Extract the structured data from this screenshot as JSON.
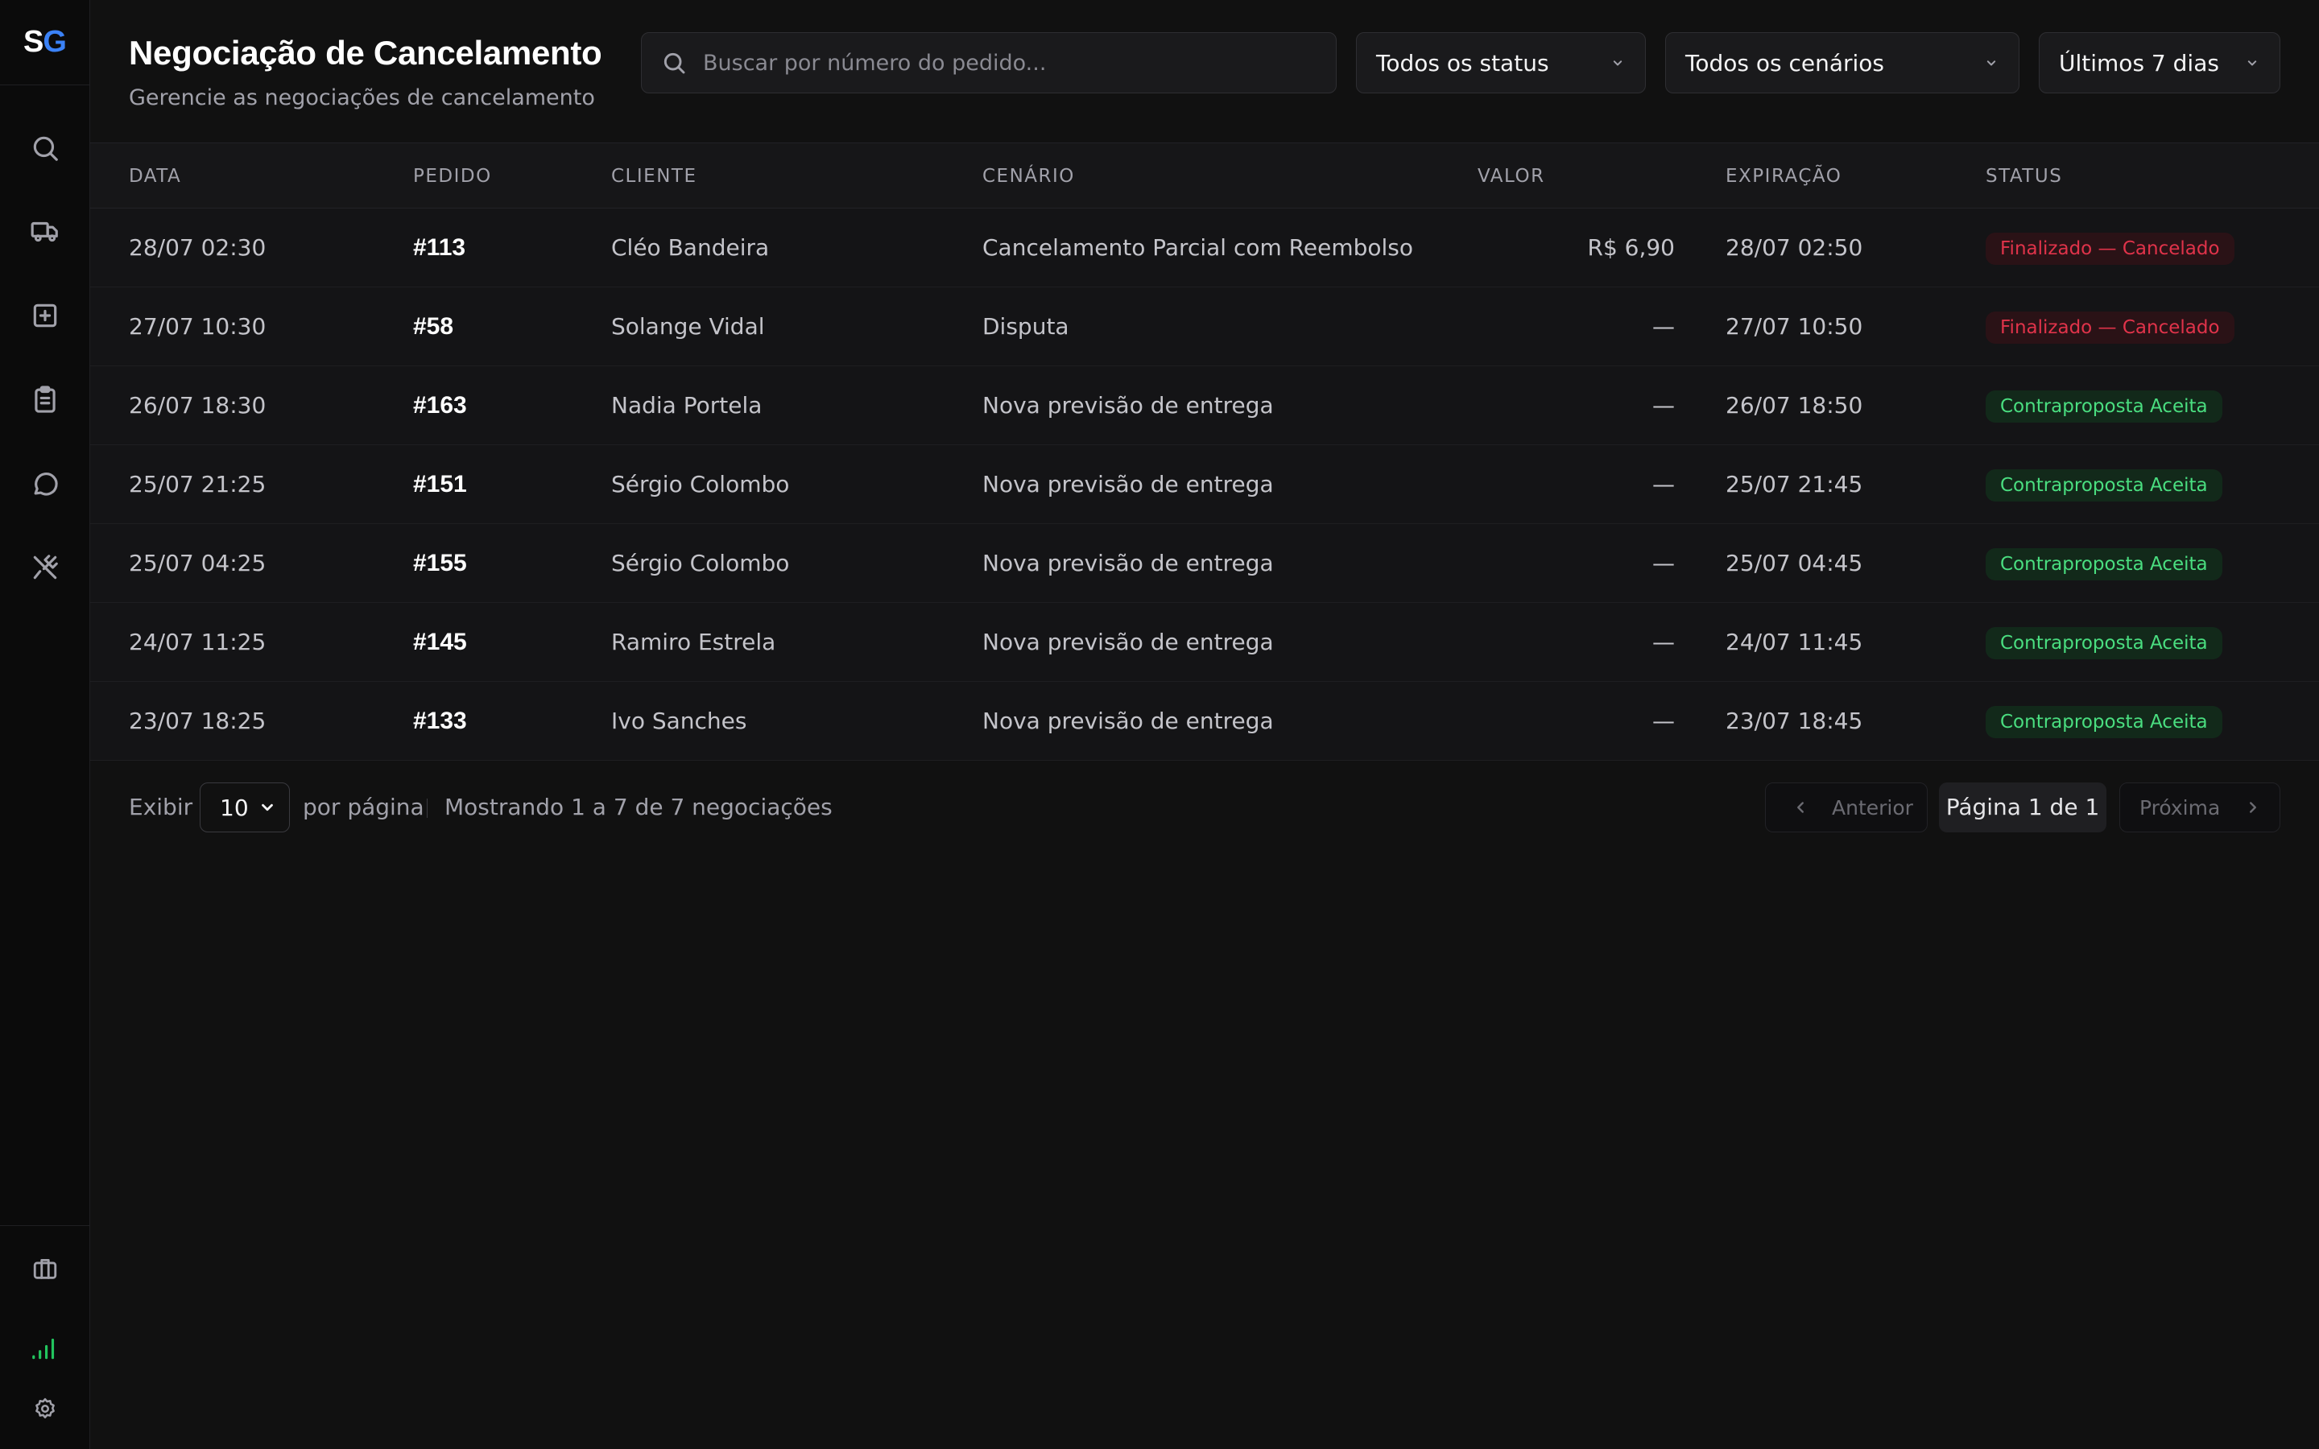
{
  "app": {
    "logo_s": "S",
    "logo_g": "G",
    "brand_color": "#3b82f6"
  },
  "sidebar": {
    "items": [
      {
        "name": "search",
        "icon": "search-icon"
      },
      {
        "name": "delivery",
        "icon": "truck-icon"
      },
      {
        "name": "add",
        "icon": "plus-square-icon"
      },
      {
        "name": "orders",
        "icon": "clipboard-icon"
      },
      {
        "name": "chat",
        "icon": "message-circle-icon"
      },
      {
        "name": "restaurant",
        "icon": "utensils-crossed-icon"
      }
    ],
    "bottom_items": [
      {
        "name": "store",
        "icon": "briefcase-icon"
      },
      {
        "name": "signal",
        "icon": "signal-icon",
        "color": "#22c55e"
      },
      {
        "name": "settings",
        "icon": "gear-icon"
      }
    ]
  },
  "header": {
    "title": "Negociação de Cancelamento",
    "subtitle": "Gerencie as negociações de cancelamento",
    "search_placeholder": "Buscar por número do pedido...",
    "filter_status": "Todos os status",
    "filter_scenario": "Todos os cenários",
    "filter_period": "Últimos 7 dias"
  },
  "table": {
    "columns": [
      "DATA",
      "PEDIDO",
      "CLIENTE",
      "CENÁRIO",
      "VALOR",
      "EXPIRAÇÃO",
      "STATUS"
    ],
    "rows": [
      {
        "date": "28/07 02:30",
        "order": "#113",
        "client": "Cléo Bandeira",
        "scenario": "Cancelamento Parcial com Reembolso",
        "value": "R$ 6,90",
        "expiration": "28/07 02:50",
        "status": "Finalizado — Cancelado",
        "status_type": "red"
      },
      {
        "date": "27/07 10:30",
        "order": "#58",
        "client": "Solange Vidal",
        "scenario": "Disputa",
        "value": "—",
        "expiration": "27/07 10:50",
        "status": "Finalizado — Cancelado",
        "status_type": "red"
      },
      {
        "date": "26/07 18:30",
        "order": "#163",
        "client": "Nadia Portela",
        "scenario": "Nova previsão de entrega",
        "value": "—",
        "expiration": "26/07 18:50",
        "status": "Contraproposta Aceita",
        "status_type": "green"
      },
      {
        "date": "25/07 21:25",
        "order": "#151",
        "client": "Sérgio Colombo",
        "scenario": "Nova previsão de entrega",
        "value": "—",
        "expiration": "25/07 21:45",
        "status": "Contraproposta Aceita",
        "status_type": "green"
      },
      {
        "date": "25/07 04:25",
        "order": "#155",
        "client": "Sérgio Colombo",
        "scenario": "Nova previsão de entrega",
        "value": "—",
        "expiration": "25/07 04:45",
        "status": "Contraproposta Aceita",
        "status_type": "green"
      },
      {
        "date": "24/07 11:25",
        "order": "#145",
        "client": "Ramiro Estrela",
        "scenario": "Nova previsão de entrega",
        "value": "—",
        "expiration": "24/07 11:45",
        "status": "Contraproposta Aceita",
        "status_type": "green"
      },
      {
        "date": "23/07 18:25",
        "order": "#133",
        "client": "Ivo Sanches",
        "scenario": "Nova previsão de entrega",
        "value": "—",
        "expiration": "23/07 18:45",
        "status": "Contraproposta Aceita",
        "status_type": "green"
      }
    ]
  },
  "footer": {
    "show_label": "Exibir",
    "per_page_value": "10",
    "per_page_label": "por página",
    "showing": "Mostrando 1 a 7 de 7 negociações",
    "prev_label": "Anterior",
    "page_label": "Página 1 de 1",
    "next_label": "Próxima"
  }
}
